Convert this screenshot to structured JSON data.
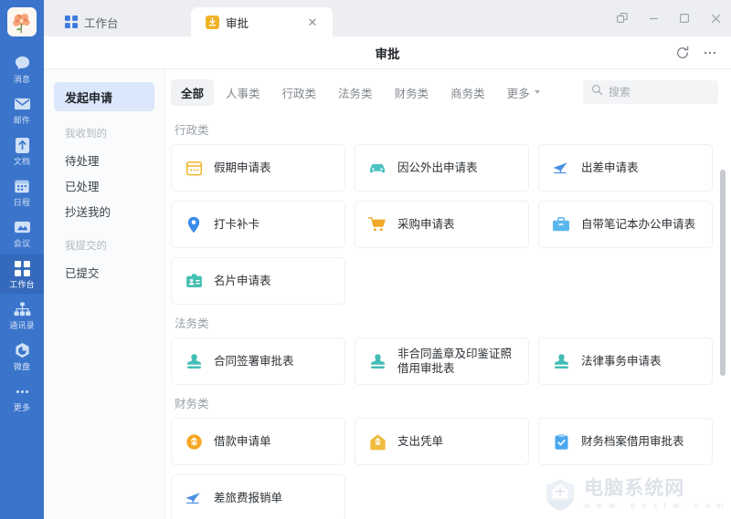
{
  "rail": {
    "avatar_name": "user-avatar-flower",
    "items": [
      {
        "label": "消息",
        "icon": "message-icon",
        "active": false
      },
      {
        "label": "邮件",
        "icon": "mail-icon",
        "active": false
      },
      {
        "label": "文档",
        "icon": "document-icon",
        "active": false
      },
      {
        "label": "日程",
        "icon": "calendar-icon",
        "active": false
      },
      {
        "label": "会议",
        "icon": "meeting-icon",
        "active": false
      },
      {
        "label": "工作台",
        "icon": "workbench-icon",
        "active": true
      },
      {
        "label": "通讯录",
        "icon": "contacts-icon",
        "active": false
      },
      {
        "label": "微盘",
        "icon": "cloud-disk-icon",
        "active": false
      },
      {
        "label": "更多",
        "icon": "more-dots-icon",
        "active": false
      }
    ]
  },
  "tabs": [
    {
      "label": "工作台",
      "icon": "workbench-tab-icon",
      "active": false,
      "closable": false
    },
    {
      "label": "审批",
      "icon": "approval-tab-icon",
      "active": true,
      "closable": true
    }
  ],
  "window_controls": [
    {
      "name": "popout-button",
      "glyph": "⧉"
    },
    {
      "name": "minimize-button",
      "glyph": "—"
    },
    {
      "name": "maximize-button",
      "glyph": "▢"
    },
    {
      "name": "close-button",
      "glyph": "✕"
    }
  ],
  "header": {
    "title": "审批",
    "refresh_label": "刷新",
    "more_label": "更多"
  },
  "nav": {
    "primary": "发起申请",
    "groups": [
      {
        "title": "我收到的",
        "items": [
          "待处理",
          "已处理",
          "抄送我的"
        ]
      },
      {
        "title": "我提交的",
        "items": [
          "已提交"
        ]
      }
    ]
  },
  "filters": {
    "chips": [
      {
        "label": "全部",
        "active": true,
        "caret": false
      },
      {
        "label": "人事类",
        "active": false,
        "caret": false
      },
      {
        "label": "行政类",
        "active": false,
        "caret": false
      },
      {
        "label": "法务类",
        "active": false,
        "caret": false
      },
      {
        "label": "财务类",
        "active": false,
        "caret": false
      },
      {
        "label": "商务类",
        "active": false,
        "caret": false
      },
      {
        "label": "更多",
        "active": false,
        "caret": true
      }
    ]
  },
  "search": {
    "placeholder": "搜索",
    "value": ""
  },
  "sections": [
    {
      "title": "行政类",
      "cards": [
        {
          "label": "假期申请表",
          "icon": "calendar-form-icon",
          "color": "#f0b429"
        },
        {
          "label": "因公外出申请表",
          "icon": "car-icon",
          "color": "#4ec3c3"
        },
        {
          "label": "出差申请表",
          "icon": "airplane-icon",
          "color": "#4a90e2"
        },
        {
          "label": "打卡补卡",
          "icon": "location-pin-icon",
          "color": "#3b8ce8"
        },
        {
          "label": "采购申请表",
          "icon": "shopping-cart-icon",
          "color": "#f0a828"
        },
        {
          "label": "自带笔记本办公申请表",
          "icon": "briefcase-icon",
          "color": "#5bb8ee"
        },
        {
          "label": "名片申请表",
          "icon": "business-card-icon",
          "color": "#45bfb0"
        }
      ]
    },
    {
      "title": "法务类",
      "cards": [
        {
          "label": "合同签署审批表",
          "icon": "stamp-icon",
          "color": "#44bdb7"
        },
        {
          "label": "非合同盖章及印鉴证照\n借用审批表",
          "icon": "stamp-icon",
          "color": "#44bdb7"
        },
        {
          "label": "法律事务申请表",
          "icon": "stamp-icon",
          "color": "#44bdb7"
        }
      ]
    },
    {
      "title": "财务类",
      "cards": [
        {
          "label": "借款申请单",
          "icon": "coin-icon",
          "color": "#f5a623"
        },
        {
          "label": "支出凭单",
          "icon": "voucher-house-icon",
          "color": "#f0bb3e"
        },
        {
          "label": "财务档案借用审批表",
          "icon": "clipboard-check-icon",
          "color": "#4aa8ef"
        },
        {
          "label": "差旅费报销单",
          "icon": "airplane-icon",
          "color": "#4a90e2"
        }
      ]
    }
  ],
  "watermark": {
    "main": "电脑系统网",
    "sub": "w w w . d n x t w . c o m"
  },
  "colors": {
    "rail_bg": "#3a74cb",
    "rail_active": "#3569bb",
    "nav_primary_bg": "#dbe7fa",
    "tab_active_bg": "#ffffff",
    "tabstrip_bg": "#eceef1"
  }
}
